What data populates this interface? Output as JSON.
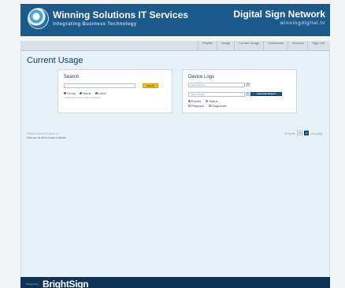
{
  "header": {
    "brand_title": "Winning Solutions IT Services",
    "brand_subtitle": "Integrating Business Technology",
    "product_title": "Digital Sign Network",
    "product_subtitle": "winningdigital.tv"
  },
  "nav": {
    "tabs": [
      "Playlist",
      "Usage",
      "Current Usage",
      "Downloads",
      "Account",
      "Sign Out"
    ]
  },
  "page": {
    "title": "Current Usage"
  },
  "search": {
    "title": "Search",
    "input_value": "",
    "button_label": "Search",
    "options": [
      {
        "label": "Group",
        "checked": true
      },
      {
        "label": "Name",
        "checked": true
      },
      {
        "label": "Label",
        "checked": true
      }
    ],
    "hint": "* Search terms are case insensitive"
  },
  "device_logs": {
    "title": "Device Logs",
    "device_select": "Select Device",
    "report_select": "Select Report",
    "button_label": "Generate Report",
    "row1": [
      {
        "label": "Events",
        "selected": true
      },
      {
        "label": "Status",
        "selected": false
      }
    ],
    "row2": [
      {
        "label": "Playback",
        "selected": false
      },
      {
        "label": "Diagnostic",
        "selected": false
      }
    ]
  },
  "results": {
    "total_label": "Total Devices Count: 0",
    "empty_message": "There are no items to show in this list",
    "pager_prefix": "Results",
    "page_size": "25",
    "pager_suffix": "per page"
  },
  "footer": {
    "powered_by": "Powered by",
    "logo_text": "BrightSign"
  },
  "colors": {
    "header": "#1b5a8a",
    "content_bg": "#e6f1f8",
    "search_button": "#f2c21c",
    "footer": "#0f3354"
  }
}
